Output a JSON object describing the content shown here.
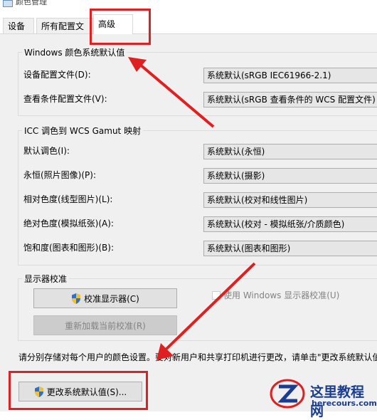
{
  "window": {
    "title": "颜色管理"
  },
  "tabs": [
    {
      "label": "设备",
      "selected": false
    },
    {
      "label": "所有配置文件",
      "selected": false
    },
    {
      "label": "高级",
      "selected": true
    }
  ],
  "windows_defaults": {
    "legend": "Windows 颜色系统默认值",
    "device_profile": {
      "label": "设备配置文件(D):",
      "value": "系统默认(sRGB IEC61966-2.1)"
    },
    "viewing_conditions": {
      "label": "查看条件配置文件(V):",
      "value": "系统默认(sRGB 查看条件的 WCS 配置文件)"
    }
  },
  "icc_mapping": {
    "legend": "ICC 调色到 WCS Gamut 映射",
    "rows": [
      {
        "label": "默认调色(I):",
        "value": "系统默认(永恒)"
      },
      {
        "label": "永恒(照片图像)(P):",
        "value": "系统默认(摄影)"
      },
      {
        "label": "相对色度(线型图片)(L):",
        "value": "系统默认(校对和线性图片)"
      },
      {
        "label": "绝对色度(模拟纸张)(A):",
        "value": "系统默认(校对 - 模拟纸张/介质颜色)"
      },
      {
        "label": "饱和度(图表和图形)(B):",
        "value": "系统默认(图表和图形)"
      }
    ]
  },
  "calibration": {
    "legend": "显示器校准",
    "calibrate_button": "校准显示器(C)",
    "reload_button": "重新加载当前校准(R)",
    "use_windows_checkbox": "使用 Windows 显示器校准(U)",
    "use_windows_checked": false
  },
  "footer": {
    "note": "请分别存储对每个用户的颜色设置。要对新用户和共享打印机进行更改，请单击\"更改系统默认值",
    "change_defaults_button": "更改系统默认值(S)..."
  },
  "watermark": {
    "name": "这里教程网",
    "url": "herecours.com"
  },
  "colors": {
    "annotation": "#e02020",
    "watermark": "#1a3d8f"
  }
}
